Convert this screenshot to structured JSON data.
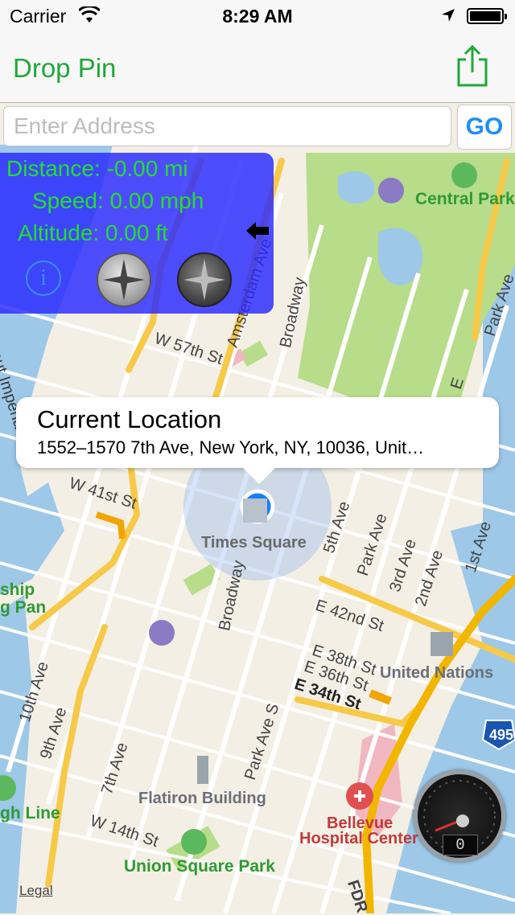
{
  "status_bar": {
    "carrier": "Carrier",
    "time": "8:29 AM",
    "wifi_icon": "wifi-icon",
    "location_icon": "location-arrow-icon",
    "battery_icon": "battery-icon"
  },
  "nav": {
    "title": "Drop Pin",
    "share_icon": "share-icon",
    "accent_color": "#1fa83a"
  },
  "search": {
    "placeholder": "Enter Address",
    "value": "",
    "go_label": "GO",
    "go_color": "#1e8ef7"
  },
  "stats": {
    "distance": "Distance: -0.00 mi",
    "speed": "Speed: 0.00 mph",
    "altitude": "Altitude: 0.00 ft",
    "info_icon": "info-icon",
    "compass_light_icon": "compass-icon",
    "compass_dark_icon": "compass-icon",
    "back_icon": "arrow-left-icon",
    "text_color": "#22e02a",
    "panel_color": "#2828ff"
  },
  "callout": {
    "title": "Current Location",
    "address": "1552–1570 7th Ave, New York, NY, 10036, Unit…"
  },
  "map": {
    "labels": {
      "central_park": "Central Park",
      "times_square": "Times Square",
      "united_nations": "United Nations",
      "flatiron": "Flatiron Building",
      "bellevue_1": "Bellevue",
      "bellevue_2": "Hospital Center",
      "union_square": "Union Square Park",
      "high_line": "gh Line",
      "ship_1": "ship",
      "ship_2": "g Pan",
      "route_imperial": "Rout Imperial",
      "hwy_495": "495",
      "fdr": "FDR",
      "w57": "W 57th St",
      "w41": "W 41st St",
      "w14": "W 14th St",
      "e42": "E 42nd St",
      "e38": "E 38th St",
      "e36": "E 36th St",
      "e34": "E 34th St",
      "amsterdam": "Amsterdam Ave",
      "broadway_top": "Broadway",
      "broadway_mid": "Broadway",
      "fifth_ave": "5th Ave",
      "park_ave": "Park Ave",
      "third_ave": "3rd Ave",
      "second_ave": "2nd Ave",
      "first_ave": "1st Ave",
      "tenth_ave": "10th Ave",
      "ninth_ave": "9th Ave",
      "seventh_ave": "7th Ave",
      "park_ave_s": "Park Ave S",
      "park_ave_top": "Park Ave",
      "e_top": "E"
    },
    "legal": "Legal"
  },
  "speedometer": {
    "readout": "0",
    "icon": "speedometer-icon"
  }
}
